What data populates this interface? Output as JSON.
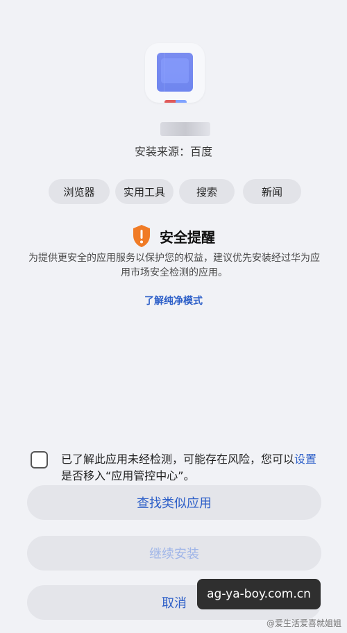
{
  "app": {
    "source_label": "安装来源：百度"
  },
  "tags": [
    "浏览器",
    "实用工具",
    "搜索",
    "新闻"
  ],
  "notice": {
    "title": "安全提醒",
    "text": "为提供更安全的应用服务以保护您的权益，建议优先安装经过华为应用市场安全检测的应用。",
    "learn_more": "了解纯净模式"
  },
  "consent": {
    "part1": "已了解此应用未经检测，可能存在风险，您可以",
    "settings_link": "设置",
    "part2": "是否移入“应用管控中心”。",
    "checked": false
  },
  "buttons": {
    "find_similar": "查找类似应用",
    "continue_install": "继续安装",
    "cancel": "取消"
  },
  "overlay": {
    "watermark": "ag-ya-boy.com.cn",
    "footer": "@爱生活爱喜就姐姐"
  },
  "colors": {
    "accent": "#2d5fc8",
    "shield": "#f07b26"
  },
  "icons": {
    "shield": "warning-shield-icon"
  }
}
